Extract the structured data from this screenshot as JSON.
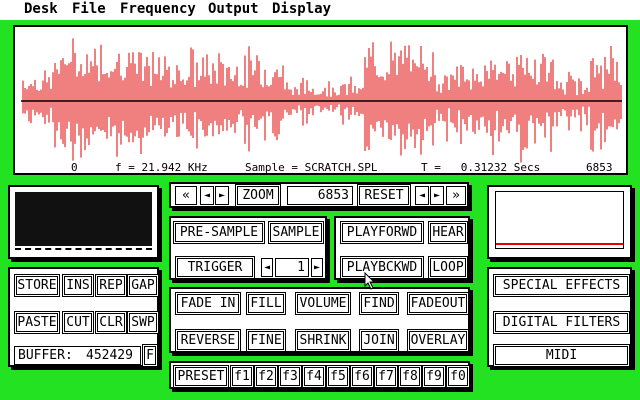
{
  "menu": [
    "Desk",
    "File",
    "Frequency",
    "Output",
    "Display"
  ],
  "status": {
    "start": "0",
    "freq": "f = 21.942 KHz",
    "sample": "Sample = SCRATCH.SPL",
    "time": "T =   0.31232 Secs",
    "end": "6853"
  },
  "toolbar": {
    "zoom_label": "ZOOM",
    "zoom_value": "6853",
    "reset_label": "RESET",
    "left_double": "«",
    "right_double": "»",
    "left_arrow": "◄",
    "right_arrow": "►"
  },
  "sample_panel": {
    "pre_sample": "PRE-SAMPLE",
    "sample": "SAMPLE",
    "trigger": "TRIGGER",
    "trigger_value": "1",
    "down_arrow": "◄",
    "up_arrow": "►"
  },
  "play_panel": {
    "play_forward": "PLAYFORWD",
    "hear": "HEAR",
    "play_backward": "PLAYBCKWD",
    "loop": "LOOP"
  },
  "edit_panel": {
    "store": "STORE",
    "ins": "INS",
    "rep": "REP",
    "gap": "GAP",
    "paste": "PASTE",
    "cut": "CUT",
    "clr": "CLR",
    "swp": "SWP",
    "buffer_label": "BUFFER:",
    "buffer_value": "452429",
    "f": "F"
  },
  "process_panel": {
    "fade_in": "FADE IN",
    "fill": "FILL",
    "volume": "VOLUME",
    "find": "FIND",
    "fadeout": "FADEOUT",
    "reverse": "REVERSE",
    "fine": "FINE",
    "shrink": "SHRINK",
    "join": "JOIN",
    "overlay": "OVERLAY"
  },
  "effects_panel": {
    "special": "SPECIAL  EFFECTS",
    "digital": "DIGITAL  FILTERS",
    "midi": "MIDI"
  },
  "presets": {
    "label": "PRESET",
    "keys": [
      "f1",
      "f2",
      "f3",
      "f4",
      "f5",
      "f6",
      "f7",
      "f8",
      "f9",
      "f0"
    ]
  },
  "colors": {
    "desktop": "#22e222",
    "waveform": "#e00000",
    "monitor": "#111111"
  }
}
